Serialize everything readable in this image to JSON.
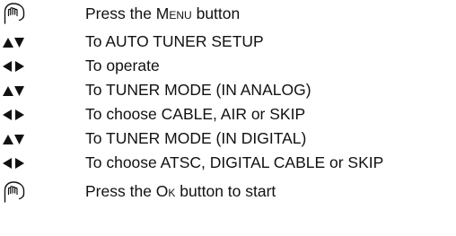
{
  "steps": [
    {
      "icon": "finger-press-icon",
      "text_before": "Press the ",
      "text_key": "Menu",
      "text_after": " button"
    },
    {
      "icon": "up-down-arrows-icon",
      "text": "To AUTO TUNER SETUP"
    },
    {
      "icon": "left-right-arrows-icon",
      "text": "To operate"
    },
    {
      "icon": "up-down-arrows-icon",
      "text": "To TUNER MODE (IN ANALOG)"
    },
    {
      "icon": "left-right-arrows-icon",
      "text": "To choose CABLE, AIR or SKIP"
    },
    {
      "icon": "up-down-arrows-icon",
      "text": "To TUNER MODE (IN DIGITAL)"
    },
    {
      "icon": "left-right-arrows-icon",
      "text": "To choose ATSC, DIGITAL CABLE or SKIP"
    },
    {
      "icon": "finger-press-icon",
      "text_before": "Press the ",
      "text_key": "Ok",
      "text_after": " button to start"
    }
  ],
  "colors": {
    "text": "#111111",
    "icon": "#111111"
  }
}
